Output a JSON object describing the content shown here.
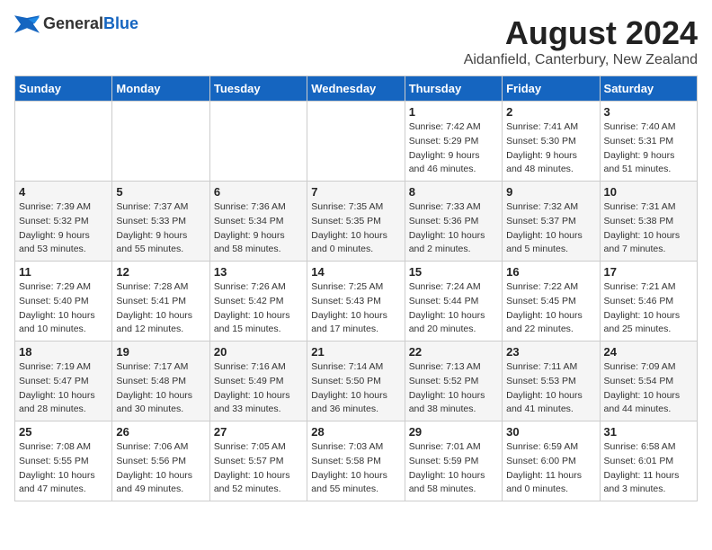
{
  "header": {
    "logo_general": "General",
    "logo_blue": "Blue",
    "main_title": "August 2024",
    "subtitle": "Aidanfield, Canterbury, New Zealand"
  },
  "calendar": {
    "days_of_week": [
      "Sunday",
      "Monday",
      "Tuesday",
      "Wednesday",
      "Thursday",
      "Friday",
      "Saturday"
    ],
    "weeks": [
      [
        {
          "day": "",
          "info": ""
        },
        {
          "day": "",
          "info": ""
        },
        {
          "day": "",
          "info": ""
        },
        {
          "day": "",
          "info": ""
        },
        {
          "day": "1",
          "info": "Sunrise: 7:42 AM\nSunset: 5:29 PM\nDaylight: 9 hours\nand 46 minutes."
        },
        {
          "day": "2",
          "info": "Sunrise: 7:41 AM\nSunset: 5:30 PM\nDaylight: 9 hours\nand 48 minutes."
        },
        {
          "day": "3",
          "info": "Sunrise: 7:40 AM\nSunset: 5:31 PM\nDaylight: 9 hours\nand 51 minutes."
        }
      ],
      [
        {
          "day": "4",
          "info": "Sunrise: 7:39 AM\nSunset: 5:32 PM\nDaylight: 9 hours\nand 53 minutes."
        },
        {
          "day": "5",
          "info": "Sunrise: 7:37 AM\nSunset: 5:33 PM\nDaylight: 9 hours\nand 55 minutes."
        },
        {
          "day": "6",
          "info": "Sunrise: 7:36 AM\nSunset: 5:34 PM\nDaylight: 9 hours\nand 58 minutes."
        },
        {
          "day": "7",
          "info": "Sunrise: 7:35 AM\nSunset: 5:35 PM\nDaylight: 10 hours\nand 0 minutes."
        },
        {
          "day": "8",
          "info": "Sunrise: 7:33 AM\nSunset: 5:36 PM\nDaylight: 10 hours\nand 2 minutes."
        },
        {
          "day": "9",
          "info": "Sunrise: 7:32 AM\nSunset: 5:37 PM\nDaylight: 10 hours\nand 5 minutes."
        },
        {
          "day": "10",
          "info": "Sunrise: 7:31 AM\nSunset: 5:38 PM\nDaylight: 10 hours\nand 7 minutes."
        }
      ],
      [
        {
          "day": "11",
          "info": "Sunrise: 7:29 AM\nSunset: 5:40 PM\nDaylight: 10 hours\nand 10 minutes."
        },
        {
          "day": "12",
          "info": "Sunrise: 7:28 AM\nSunset: 5:41 PM\nDaylight: 10 hours\nand 12 minutes."
        },
        {
          "day": "13",
          "info": "Sunrise: 7:26 AM\nSunset: 5:42 PM\nDaylight: 10 hours\nand 15 minutes."
        },
        {
          "day": "14",
          "info": "Sunrise: 7:25 AM\nSunset: 5:43 PM\nDaylight: 10 hours\nand 17 minutes."
        },
        {
          "day": "15",
          "info": "Sunrise: 7:24 AM\nSunset: 5:44 PM\nDaylight: 10 hours\nand 20 minutes."
        },
        {
          "day": "16",
          "info": "Sunrise: 7:22 AM\nSunset: 5:45 PM\nDaylight: 10 hours\nand 22 minutes."
        },
        {
          "day": "17",
          "info": "Sunrise: 7:21 AM\nSunset: 5:46 PM\nDaylight: 10 hours\nand 25 minutes."
        }
      ],
      [
        {
          "day": "18",
          "info": "Sunrise: 7:19 AM\nSunset: 5:47 PM\nDaylight: 10 hours\nand 28 minutes."
        },
        {
          "day": "19",
          "info": "Sunrise: 7:17 AM\nSunset: 5:48 PM\nDaylight: 10 hours\nand 30 minutes."
        },
        {
          "day": "20",
          "info": "Sunrise: 7:16 AM\nSunset: 5:49 PM\nDaylight: 10 hours\nand 33 minutes."
        },
        {
          "day": "21",
          "info": "Sunrise: 7:14 AM\nSunset: 5:50 PM\nDaylight: 10 hours\nand 36 minutes."
        },
        {
          "day": "22",
          "info": "Sunrise: 7:13 AM\nSunset: 5:52 PM\nDaylight: 10 hours\nand 38 minutes."
        },
        {
          "day": "23",
          "info": "Sunrise: 7:11 AM\nSunset: 5:53 PM\nDaylight: 10 hours\nand 41 minutes."
        },
        {
          "day": "24",
          "info": "Sunrise: 7:09 AM\nSunset: 5:54 PM\nDaylight: 10 hours\nand 44 minutes."
        }
      ],
      [
        {
          "day": "25",
          "info": "Sunrise: 7:08 AM\nSunset: 5:55 PM\nDaylight: 10 hours\nand 47 minutes."
        },
        {
          "day": "26",
          "info": "Sunrise: 7:06 AM\nSunset: 5:56 PM\nDaylight: 10 hours\nand 49 minutes."
        },
        {
          "day": "27",
          "info": "Sunrise: 7:05 AM\nSunset: 5:57 PM\nDaylight: 10 hours\nand 52 minutes."
        },
        {
          "day": "28",
          "info": "Sunrise: 7:03 AM\nSunset: 5:58 PM\nDaylight: 10 hours\nand 55 minutes."
        },
        {
          "day": "29",
          "info": "Sunrise: 7:01 AM\nSunset: 5:59 PM\nDaylight: 10 hours\nand 58 minutes."
        },
        {
          "day": "30",
          "info": "Sunrise: 6:59 AM\nSunset: 6:00 PM\nDaylight: 11 hours\nand 0 minutes."
        },
        {
          "day": "31",
          "info": "Sunrise: 6:58 AM\nSunset: 6:01 PM\nDaylight: 11 hours\nand 3 minutes."
        }
      ]
    ]
  }
}
